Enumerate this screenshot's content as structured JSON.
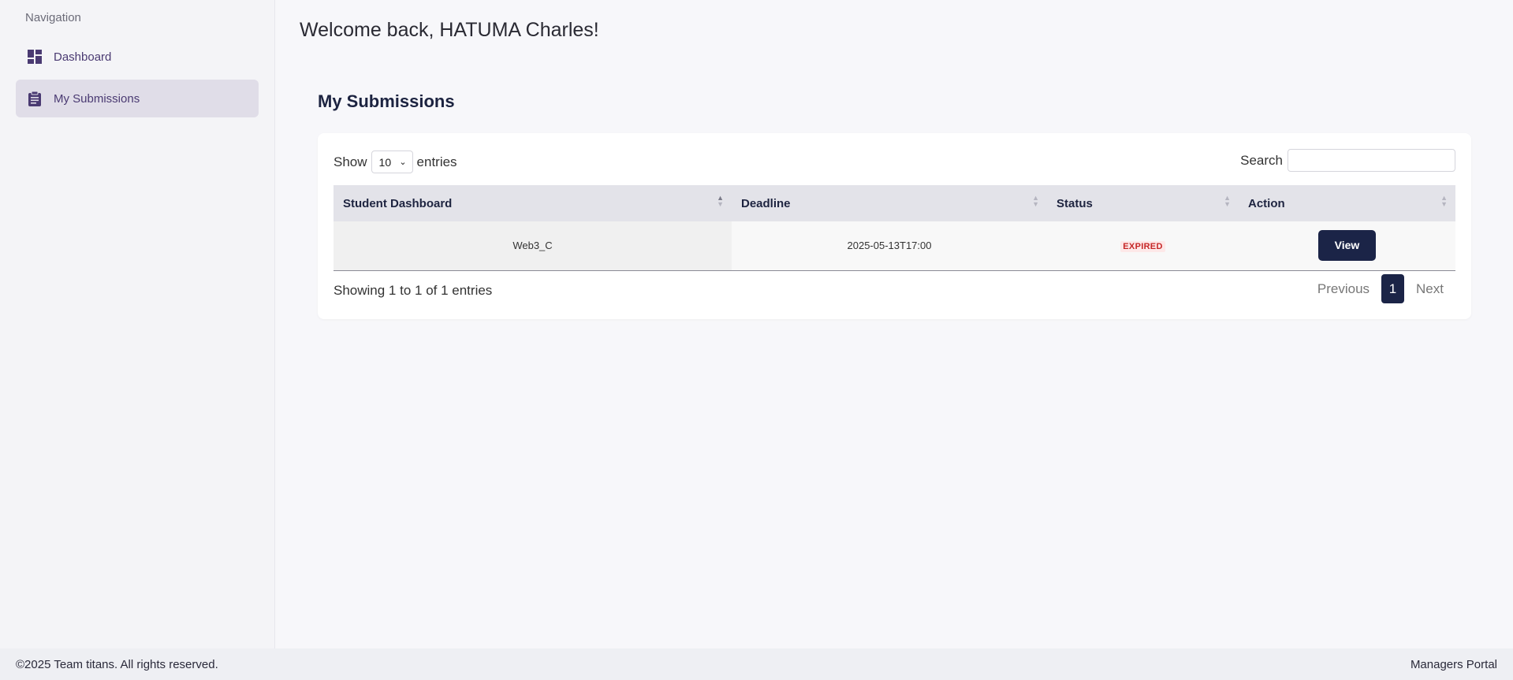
{
  "sidebar": {
    "heading": "Navigation",
    "items": [
      {
        "label": "Dashboard",
        "icon": "dashboard-icon",
        "active": false
      },
      {
        "label": "My Submissions",
        "icon": "clipboard-icon",
        "active": true
      }
    ]
  },
  "main": {
    "welcome": "Welcome back, HATUMA Charles!",
    "section_title": "My Submissions",
    "table_controls": {
      "show_label": "Show",
      "entries_label": "entries",
      "page_length": "10",
      "search_label": "Search",
      "search_value": ""
    },
    "table": {
      "columns": [
        "Student Dashboard",
        "Deadline",
        "Status",
        "Action"
      ],
      "rows": [
        {
          "name": "Web3_C",
          "deadline": "2025-05-13T17:00",
          "status": "EXPIRED",
          "action": "View"
        }
      ]
    },
    "info": "Showing 1 to 1 of 1 entries",
    "pagination": {
      "previous": "Previous",
      "current": "1",
      "next": "Next"
    }
  },
  "footer": {
    "copyright": "©2025 Team titans. All rights reserved.",
    "portal_link": "Managers Portal"
  },
  "colors": {
    "accent": "#1b2447",
    "sidebar_active": "#e0dde8",
    "expired": "#c62828"
  }
}
